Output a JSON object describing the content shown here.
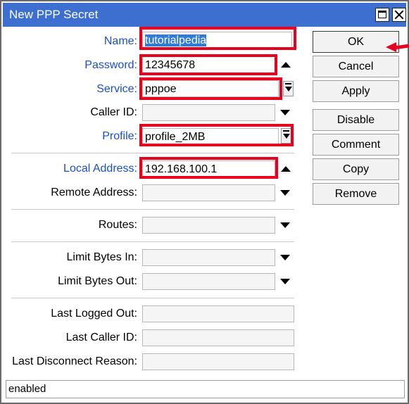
{
  "window": {
    "title": "New PPP Secret"
  },
  "fields": {
    "name": {
      "label": "Name:",
      "value": "tutorialpedia"
    },
    "password": {
      "label": "Password:",
      "value": "12345678"
    },
    "service": {
      "label": "Service:",
      "value": "pppoe"
    },
    "caller_id": {
      "label": "Caller ID:",
      "value": ""
    },
    "profile": {
      "label": "Profile:",
      "value": "profile_2MB"
    },
    "local_address": {
      "label": "Local Address:",
      "value": "192.168.100.1"
    },
    "remote_address": {
      "label": "Remote Address:",
      "value": ""
    },
    "routes": {
      "label": "Routes:",
      "value": ""
    },
    "limit_bytes_in": {
      "label": "Limit Bytes In:",
      "value": ""
    },
    "limit_bytes_out": {
      "label": "Limit Bytes Out:",
      "value": ""
    },
    "last_logged_out": {
      "label": "Last Logged Out:",
      "value": ""
    },
    "last_caller_id": {
      "label": "Last Caller ID:",
      "value": ""
    },
    "last_disconnect_reason": {
      "label": "Last Disconnect Reason:",
      "value": ""
    }
  },
  "buttons": {
    "ok": "OK",
    "cancel": "Cancel",
    "apply": "Apply",
    "disable": "Disable",
    "comment": "Comment",
    "copy": "Copy",
    "remove": "Remove"
  },
  "status": "enabled",
  "colors": {
    "title_bar": "#3c6fcf",
    "highlight_box": "#e8001f",
    "label_blue": "#1a4fd0"
  }
}
